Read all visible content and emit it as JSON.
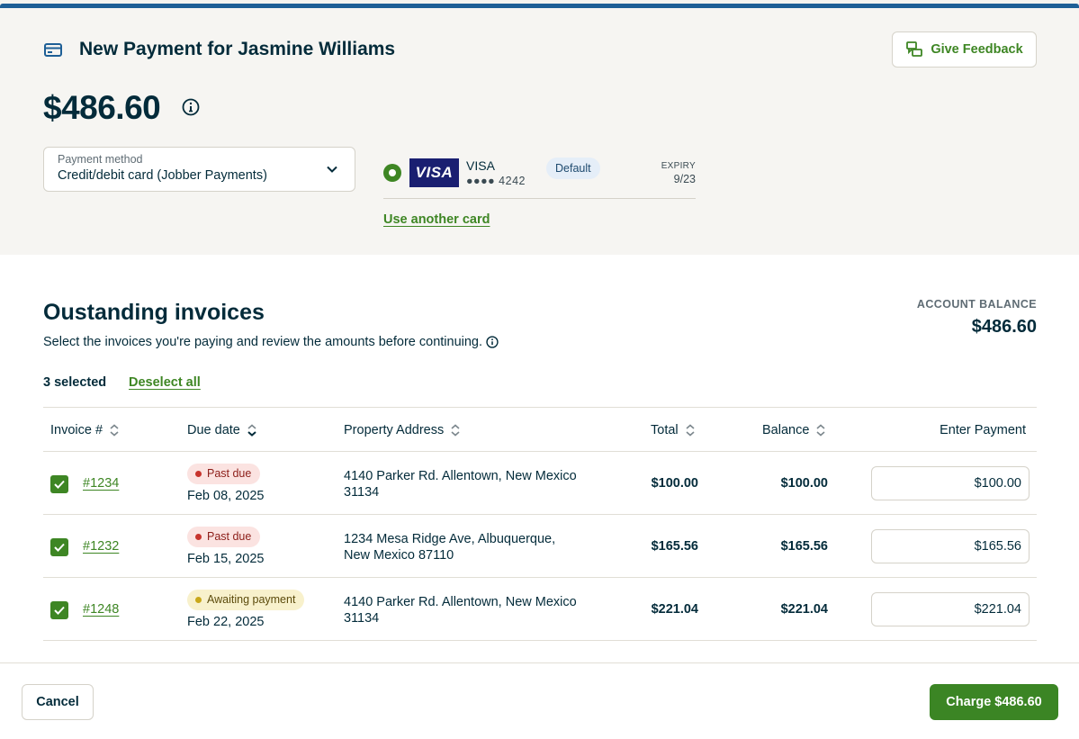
{
  "header": {
    "title": "New Payment for Jasmine Williams",
    "feedback_label": "Give Feedback",
    "amount": "$486.60"
  },
  "payment_method": {
    "label": "Payment method",
    "value": "Credit/debit card (Jobber Payments)"
  },
  "card": {
    "logo_text": "VISA",
    "brand": "VISA",
    "digits": "●●●● 4242",
    "default_badge": "Default",
    "expiry_label": "EXPIRY",
    "expiry_value": "9/23",
    "another_card_label": "Use another card"
  },
  "invoices_section": {
    "title": "Oustanding invoices",
    "subtitle": "Select the invoices you're paying and review the amounts before continuing.",
    "account_balance_label": "ACCOUNT BALANCE",
    "account_balance_value": "$486.60",
    "selected_count": "3 selected",
    "deselect_label": "Deselect all"
  },
  "table": {
    "headers": {
      "invoice": "Invoice #",
      "due_date": "Due date",
      "address": "Property Address",
      "total": "Total",
      "balance": "Balance",
      "payment": "Enter Payment"
    },
    "rows": [
      {
        "checked": true,
        "invoice": "#1234",
        "status": "Past due",
        "due": "Feb 08, 2025",
        "address": "4140 Parker Rd. Allentown, New Mexico 31134",
        "total": "$100.00",
        "balance": "$100.00",
        "payment": "$100.00"
      },
      {
        "checked": true,
        "invoice": "#1232",
        "status": "Past due",
        "due": "Feb 15, 2025",
        "address": "1234 Mesa Ridge Ave, Albuquerque, New Mexico 87110",
        "total": "$165.56",
        "balance": "$165.56",
        "payment": "$165.56"
      },
      {
        "checked": true,
        "invoice": "#1248",
        "status": "Awaiting payment",
        "due": "Feb 22, 2025",
        "address": "4140 Parker Rd. Allentown, New Mexico 31134",
        "total": "$221.04",
        "balance": "$221.04",
        "payment": "$221.04"
      }
    ]
  },
  "footer": {
    "cancel_label": "Cancel",
    "charge_label": "Charge $486.60"
  },
  "colors": {
    "accent_green": "#3e8624",
    "top_stripe": "#1e5f96",
    "text_dark": "#032b3a",
    "past_due_bg": "#fbe3e1",
    "awaiting_bg": "#f8f1cc"
  },
  "icons": {
    "title": "credit-card-icon",
    "feedback": "feedback-icon",
    "amount_info": "info-icon",
    "select": "chevron-down-icon",
    "sort": "sort-icon",
    "checkbox": "checkmark-icon"
  }
}
